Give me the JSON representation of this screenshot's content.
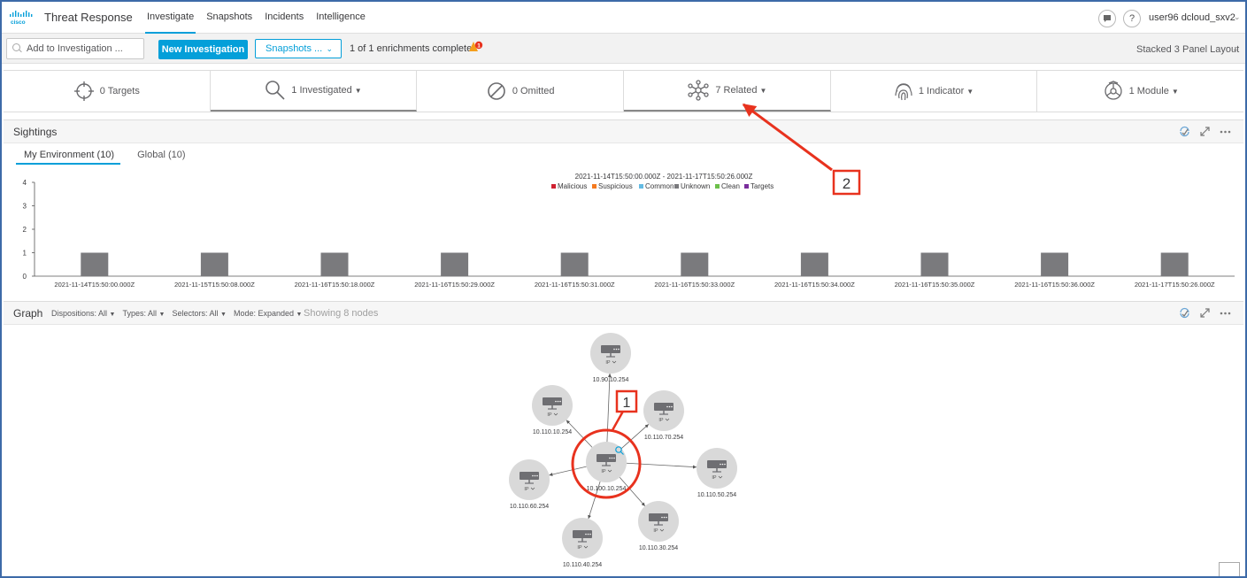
{
  "header": {
    "app_title": "Threat Response",
    "nav": [
      {
        "label": "Investigate",
        "active": true
      },
      {
        "label": "Snapshots",
        "active": false
      },
      {
        "label": "Incidents",
        "active": false
      },
      {
        "label": "Intelligence",
        "active": false
      }
    ],
    "user": "user96 dcloud_sxv2"
  },
  "toolbar": {
    "add_placeholder": "Add to Investigation ...",
    "new_investigation": "New Investigation",
    "snapshots": "Snapshots ...",
    "enrichment_status": "1 of 1 enrichments complete",
    "warning_count": "1",
    "layout": "Stacked 3 Panel Layout"
  },
  "summary": [
    {
      "label": "0 Targets",
      "icon": "crosshair-icon",
      "dropdown": false
    },
    {
      "label": "1 Investigated",
      "icon": "magnifier-icon",
      "dropdown": true,
      "active": true
    },
    {
      "label": "0 Omitted",
      "icon": "prohibited-icon",
      "dropdown": false
    },
    {
      "label": "7 Related",
      "icon": "network-icon",
      "dropdown": true,
      "active": true
    },
    {
      "label": "1 Indicator",
      "icon": "fingerprint-icon",
      "dropdown": true
    },
    {
      "label": "1 Module",
      "icon": "module-icon",
      "dropdown": true
    }
  ],
  "sightings": {
    "title": "Sightings",
    "tabs": [
      {
        "label": "My Environment (10)",
        "active": true
      },
      {
        "label": "Global (10)",
        "active": false
      }
    ]
  },
  "chart_data": {
    "type": "bar",
    "title": "2021-11-14T15:50:00.000Z - 2021-11-17T15:50:26.000Z",
    "legend": [
      {
        "name": "Malicious",
        "color": "#cf2030"
      },
      {
        "name": "Suspicious",
        "color": "#f57a1f"
      },
      {
        "name": "Common",
        "color": "#64bbe3"
      },
      {
        "name": "Unknown",
        "color": "#7a7a7d"
      },
      {
        "name": "Clean",
        "color": "#6cc04a"
      },
      {
        "name": "Targets",
        "color": "#7a2e9c"
      }
    ],
    "legend_position": "top-center",
    "categories": [
      "2021-11-14T15:50:00.000Z",
      "2021-11-15T15:50:08.000Z",
      "2021-11-16T15:50:18.000Z",
      "2021-11-16T15:50:29.000Z",
      "2021-11-16T15:50:31.000Z",
      "2021-11-16T15:50:33.000Z",
      "2021-11-16T15:50:34.000Z",
      "2021-11-16T15:50:35.000Z",
      "2021-11-16T15:50:36.000Z",
      "2021-11-17T15:50:26.000Z"
    ],
    "series": [
      {
        "name": "Unknown",
        "values": [
          1,
          1,
          1,
          1,
          1,
          1,
          1,
          1,
          1,
          1
        ]
      }
    ],
    "yticks": [
      0,
      1,
      2,
      3,
      4
    ],
    "ylim": [
      0,
      4
    ],
    "grid": false
  },
  "graph": {
    "title": "Graph",
    "filters": [
      "Dispositions: All",
      "Types: All",
      "Selectors: All",
      "Mode: Expanded"
    ],
    "showing": "Showing 8 nodes",
    "node_type_label": "IP",
    "center_node": "10.100.10.254",
    "nodes": [
      "10.90.10.254",
      "10.110.10.254",
      "10.110.70.254",
      "10.110.50.254",
      "10.110.30.254",
      "10.110.40.254",
      "10.110.60.254"
    ]
  },
  "annotations": {
    "callout_1": "1",
    "callout_2": "2",
    "callout_color": "#e8321e"
  }
}
